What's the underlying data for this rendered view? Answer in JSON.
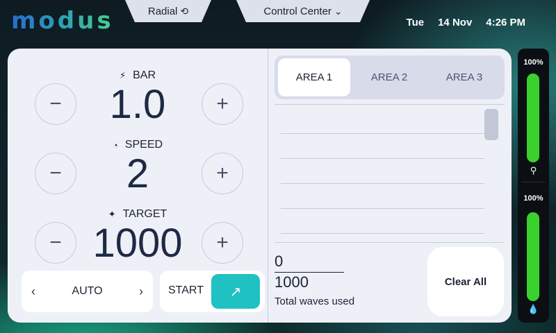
{
  "header": {
    "logo": "modus",
    "tab_radial": "Radial",
    "tab_control_center": "Control Center",
    "day": "Tue",
    "date": "14 Nov",
    "time": "4:26 PM"
  },
  "controls": {
    "bar": {
      "label": "BAR",
      "value": "1.0",
      "icon": "lightning-icon"
    },
    "speed": {
      "label": "SPEED",
      "value": "2",
      "icon": "gauge-icon"
    },
    "target": {
      "label": "TARGET",
      "value": "1000",
      "icon": "sparkle-icon"
    },
    "minus_glyph": "−",
    "plus_glyph": "+"
  },
  "mode": {
    "label": "AUTO",
    "prev": "‹",
    "next": "›"
  },
  "start": {
    "label": "START",
    "icon": "arrow-up-right-icon",
    "glyph": "↗"
  },
  "areas": {
    "tabs": [
      "AREA 1",
      "AREA 2",
      "AREA 3"
    ],
    "active_index": 0
  },
  "waves": {
    "used": "0",
    "total": "1000",
    "caption": "Total waves used"
  },
  "clear_all": "Clear All",
  "levels": {
    "top": {
      "percent_label": "100%",
      "level": 1.0,
      "icon": "pin-icon"
    },
    "bottom": {
      "percent_label": "100%",
      "level": 1.0,
      "icon": "drop-icon"
    }
  },
  "colors": {
    "accent": "#1fc1c3",
    "gauge_fill": "#3ad12e",
    "panel_bg": "#eef0f8",
    "text_dark": "#1c2233"
  }
}
